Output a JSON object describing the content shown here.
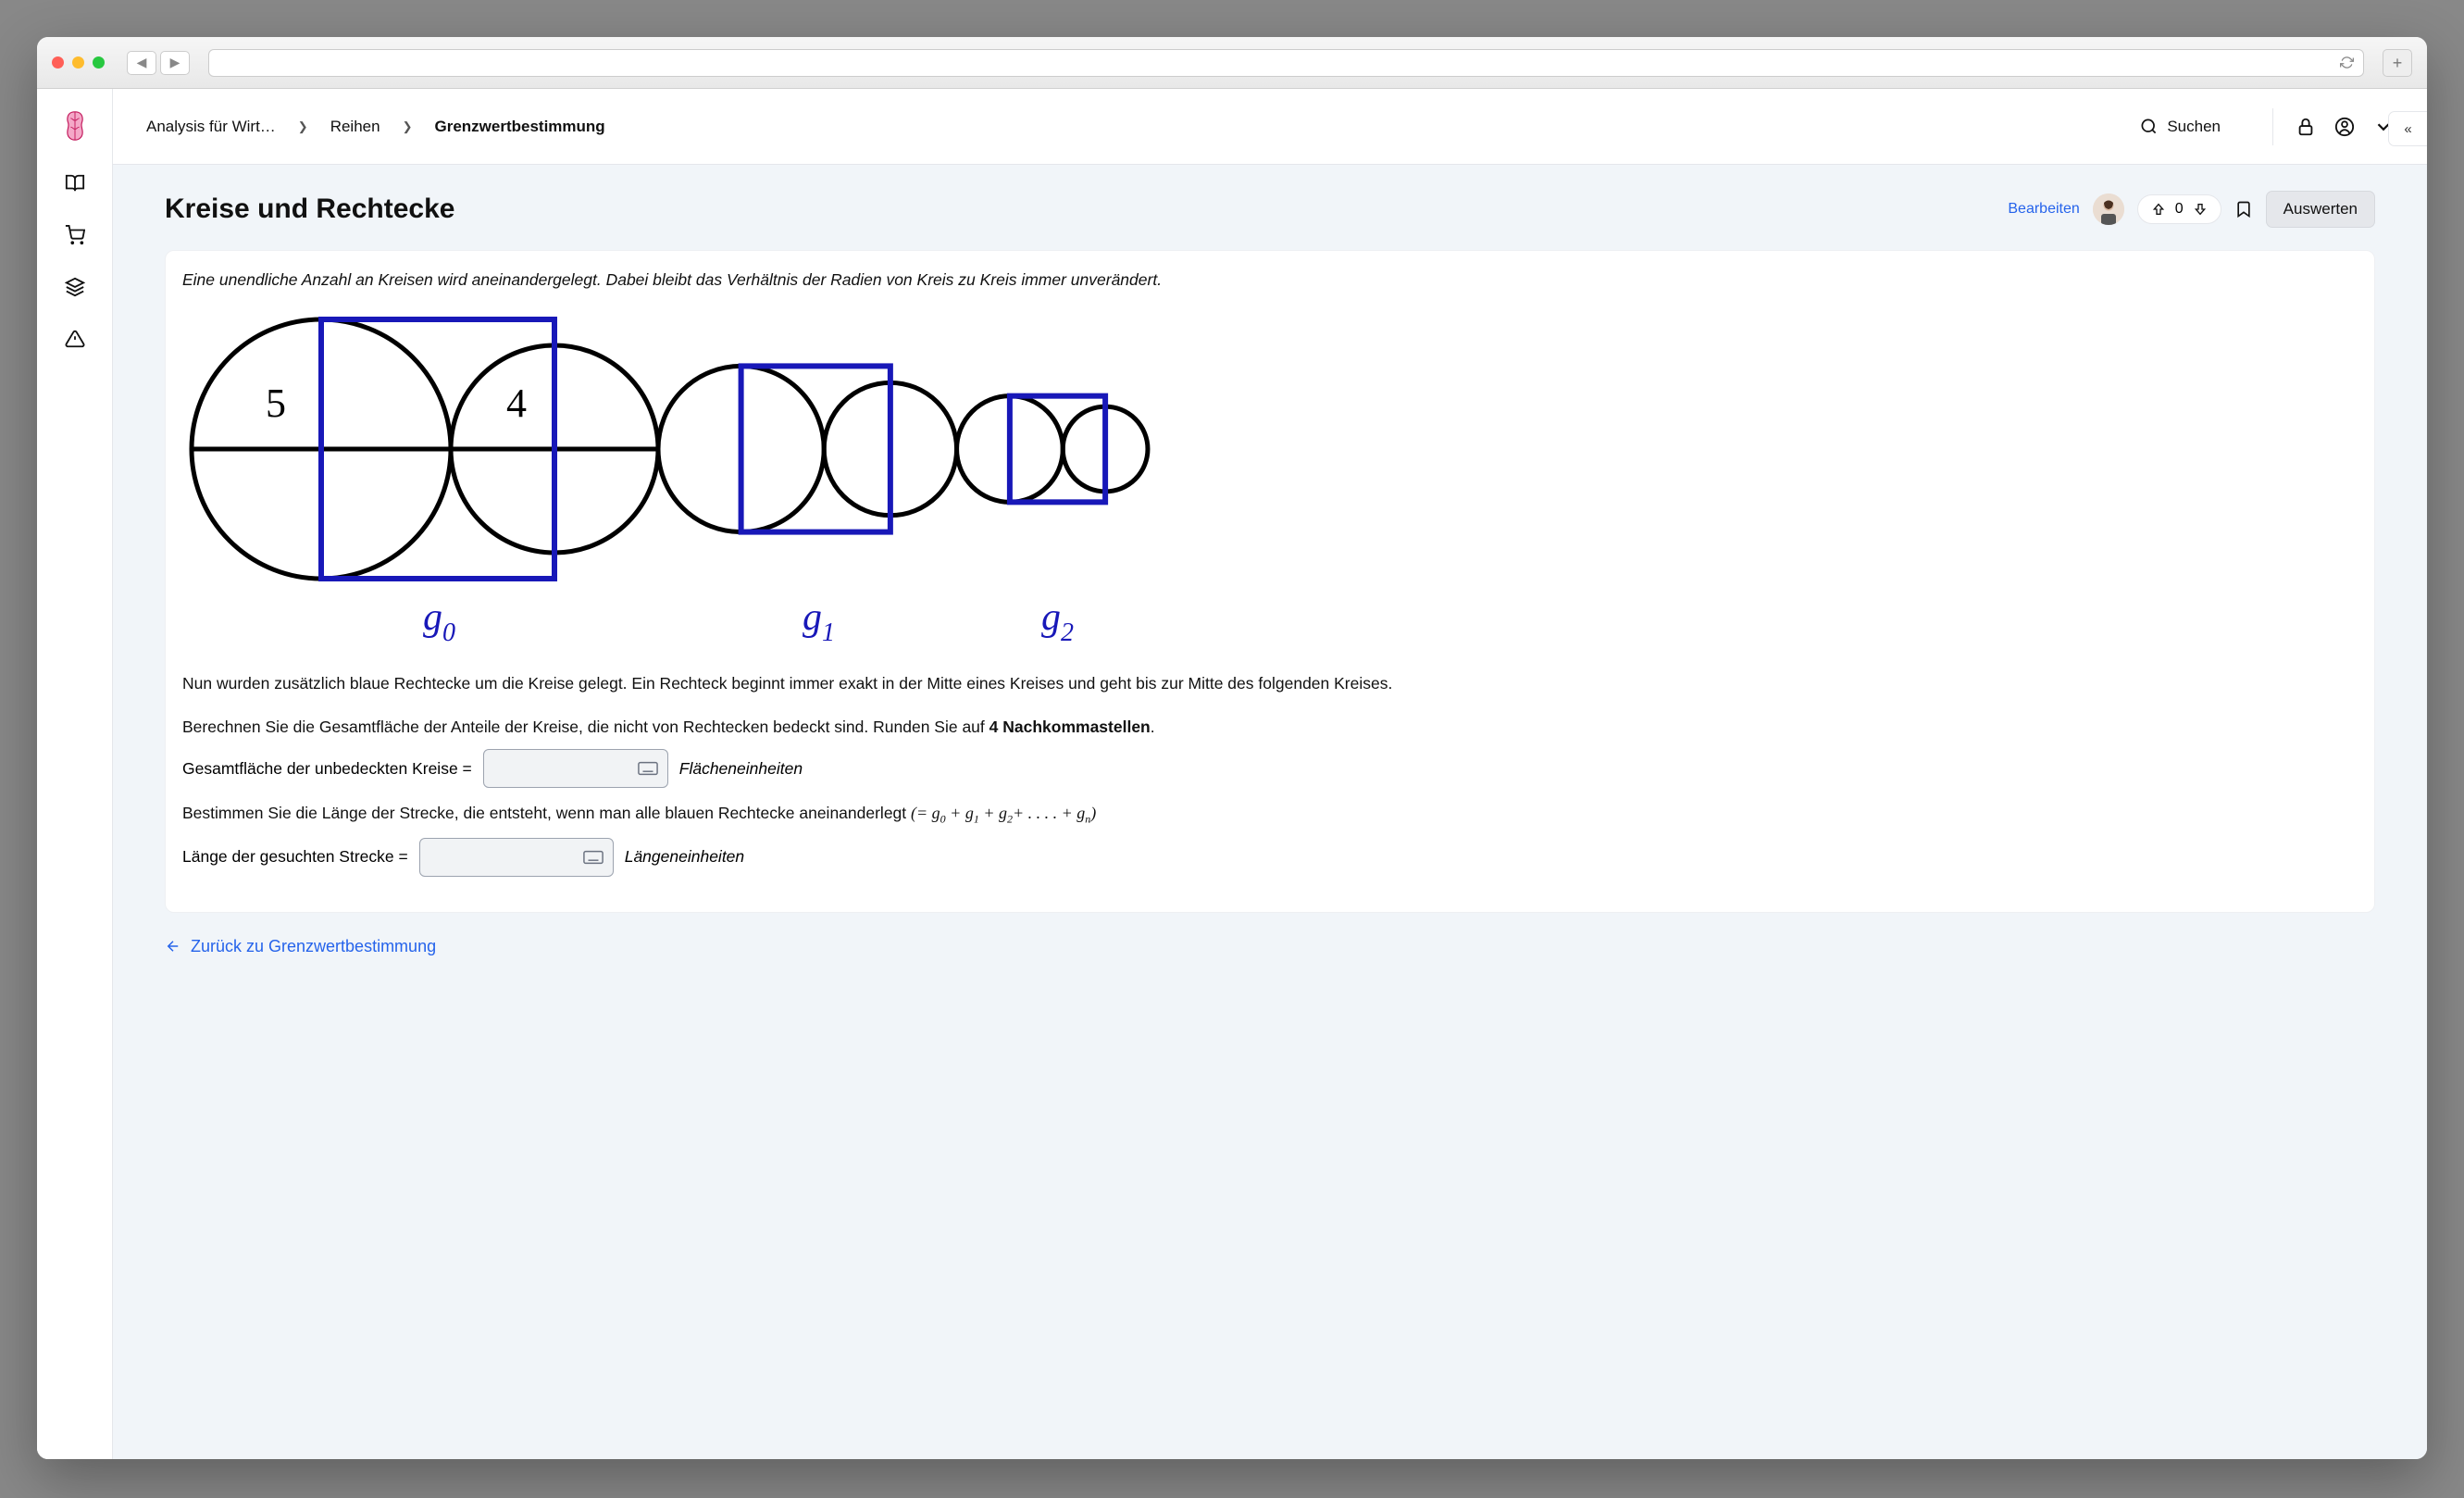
{
  "breadcrumb": {
    "seg1": "Analysis für Wirt…",
    "seg2": "Reihen",
    "seg3": "Grenzwertbestimmung"
  },
  "search_label": "Suchen",
  "page_title": "Kreise und Rechtecke",
  "edit_label": "Bearbeiten",
  "vote_count": "0",
  "eval_label": "Auswerten",
  "para1": "Eine unendliche Anzahl an Kreisen wird aneinandergelegt. Dabei bleibt das Verhältnis der Radien von Kreis zu Kreis immer unverändert.",
  "diagram": {
    "r1": "5",
    "r2": "4",
    "g0": "g",
    "g0s": "0",
    "g1": "g",
    "g1s": "1",
    "g2": "g",
    "g2s": "2"
  },
  "para2": "Nun wurden zusätzlich blaue Rechtecke um die Kreise gelegt. Ein Rechteck beginnt immer exakt in der Mitte eines Kreises und geht bis zur Mitte des folgenden Kreises.",
  "para3a": "Berechnen Sie die Gesamtfläche der Anteile der Kreise, die nicht von Rechtecken bedeckt sind. Runden Sie auf ",
  "para3b": "4 Nachkommastellen",
  "para3c": ".",
  "row1_label": "Gesamtfläche der unbedeckten Kreise =",
  "row1_unit": "Flächeneinheiten",
  "para4a": "Bestimmen Sie die Länge der Strecke, die entsteht, wenn man alle blauen Rechtecke aneinanderlegt ",
  "eq": "(= g₀ + g₁ + g₂ + . . . . + gₙ)",
  "row2_label": "Länge der gesuchten Strecke =",
  "row2_unit": "Längeneinheiten",
  "back_label": "Zurück zu Grenzwertbestimmung"
}
